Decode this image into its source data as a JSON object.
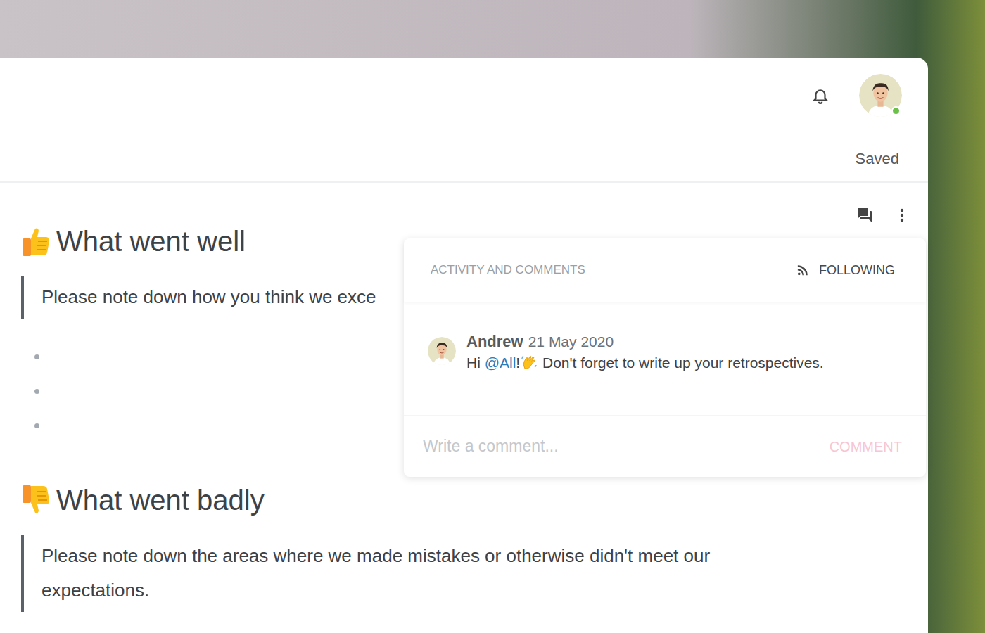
{
  "header": {
    "saved": "Saved",
    "user": {
      "online": true
    }
  },
  "sections": [
    {
      "title": "What went well",
      "kind": "up",
      "note": "Please note down how you think we exce",
      "bullets": [
        {
          "text": ""
        },
        {
          "text": ""
        },
        {
          "text": ""
        }
      ]
    },
    {
      "title": "What went badly",
      "kind": "down",
      "note": "Please note down the areas where we made mistakes or otherwise didn't meet our expectations.",
      "bullets": []
    }
  ],
  "activity": {
    "title": "ACTIVITY AND COMMENTS",
    "follow": {
      "label": "FOLLOWING",
      "on": true
    },
    "comments": [
      {
        "author": "Andrew",
        "date": "21 May 2020",
        "parts": [
          {
            "kind": "text",
            "text": "Hi "
          },
          {
            "kind": "mention",
            "text": "@All"
          },
          {
            "kind": "text",
            "text": "!"
          },
          {
            "kind": "emoji"
          },
          {
            "kind": "text",
            "text": " Don't forget to write up your retrospectives."
          }
        ]
      }
    ],
    "input": {
      "placeholder": "Write a comment..."
    },
    "submit": {
      "label": "COMMENT",
      "disabled": true
    }
  }
}
